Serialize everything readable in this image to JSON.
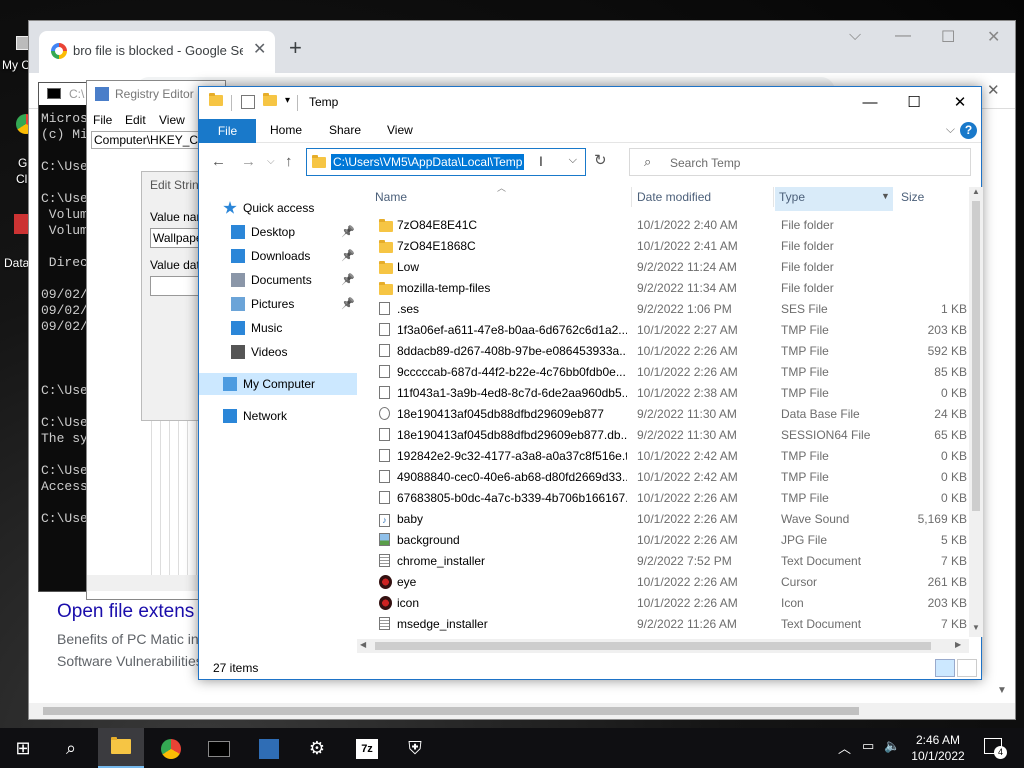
{
  "desktop": {
    "icons": [
      {
        "label": "My C",
        "icon": "my-computer-icon"
      },
      {
        "label": "G",
        "icon": "chrome-icon"
      },
      {
        "label": "Cl",
        "icon": "chrome-icon"
      },
      {
        "label": "Data",
        "icon": "data-icon"
      }
    ]
  },
  "chrome": {
    "tab_title": "bro file is blocked - Google Search",
    "new_tab_glyph": "+",
    "snippet_title": "Open file extens",
    "snippet_line1": "Benefits of PC Matic in",
    "snippet_line2": "Software Vulnerabilities"
  },
  "cmd": {
    "title": "C:\\",
    "lines": [
      "Micros",
      "(c) Mi",
      "",
      "C:\\Use",
      "",
      "C:\\Use",
      " Volum",
      " Volum",
      "",
      " Direc",
      "",
      "09/02/",
      "09/02/",
      "09/02/",
      "",
      "",
      "",
      "C:\\Use",
      "",
      "C:\\Use",
      "The sy",
      "",
      "C:\\Use",
      "Access",
      "",
      "C:\\Use"
    ]
  },
  "registry": {
    "title": "Registry Editor",
    "menu": [
      "File",
      "Edit",
      "View"
    ],
    "address": "Computer\\HKEY_CU",
    "dialog_title": "Edit Strin",
    "value_name_label": "Value nam",
    "value_name": "Wallpape",
    "value_data_label": "Value data"
  },
  "explorer": {
    "title": "Temp",
    "ribbon": {
      "file": "File",
      "tabs": [
        "Home",
        "Share",
        "View"
      ],
      "help": "?"
    },
    "address": "C:\\Users\\VM5\\AppData\\Local\\Temp",
    "search_placeholder": "Search Temp",
    "columns": {
      "name": "Name",
      "date": "Date modified",
      "type": "Type",
      "size": "Size"
    },
    "nav": [
      {
        "label": "Quick access",
        "icon": "star-icon",
        "pinned": false
      },
      {
        "label": "Desktop",
        "icon": "desktop-icon",
        "pinned": true
      },
      {
        "label": "Downloads",
        "icon": "downloads-icon",
        "pinned": true
      },
      {
        "label": "Documents",
        "icon": "documents-icon",
        "pinned": true
      },
      {
        "label": "Pictures",
        "icon": "pictures-icon",
        "pinned": true
      },
      {
        "label": "Music",
        "icon": "music-icon",
        "pinned": false
      },
      {
        "label": "Videos",
        "icon": "videos-icon",
        "pinned": false
      },
      {
        "label": "My Computer",
        "icon": "computer-icon",
        "pinned": false,
        "selected": true
      },
      {
        "label": "Network",
        "icon": "network-icon",
        "pinned": false
      }
    ],
    "files": [
      {
        "name": "7zO84E8E41C",
        "date": "10/1/2022 2:40 AM",
        "type": "File folder",
        "size": "",
        "icon": "folder"
      },
      {
        "name": "7zO84E1868C",
        "date": "10/1/2022 2:41 AM",
        "type": "File folder",
        "size": "",
        "icon": "folder"
      },
      {
        "name": "Low",
        "date": "9/2/2022 11:24 AM",
        "type": "File folder",
        "size": "",
        "icon": "folder"
      },
      {
        "name": "mozilla-temp-files",
        "date": "9/2/2022 11:34 AM",
        "type": "File folder",
        "size": "",
        "icon": "folder"
      },
      {
        "name": ".ses",
        "date": "9/2/2022 1:06 PM",
        "type": "SES File",
        "size": "1 KB",
        "icon": "doc"
      },
      {
        "name": "1f3a06ef-a611-47e8-b0aa-6d6762c6d1a2....",
        "date": "10/1/2022 2:27 AM",
        "type": "TMP File",
        "size": "203 KB",
        "icon": "doc"
      },
      {
        "name": "8ddacb89-d267-408b-97be-e086453933a...",
        "date": "10/1/2022 2:26 AM",
        "type": "TMP File",
        "size": "592 KB",
        "icon": "doc"
      },
      {
        "name": "9cccccab-687d-44f2-b22e-4c76bb0fdb0e...",
        "date": "10/1/2022 2:26 AM",
        "type": "TMP File",
        "size": "85 KB",
        "icon": "doc"
      },
      {
        "name": "11f043a1-3a9b-4ed8-8c7d-6de2aa960db5...",
        "date": "10/1/2022 2:38 AM",
        "type": "TMP File",
        "size": "0 KB",
        "icon": "doc"
      },
      {
        "name": "18e190413af045db88dfbd29609eb877",
        "date": "9/2/2022 11:30 AM",
        "type": "Data Base File",
        "size": "24 KB",
        "icon": "db"
      },
      {
        "name": "18e190413af045db88dfbd29609eb877.db....",
        "date": "9/2/2022 11:30 AM",
        "type": "SESSION64 File",
        "size": "65 KB",
        "icon": "doc"
      },
      {
        "name": "192842e2-9c32-4177-a3a8-a0a37c8f516e.t...",
        "date": "10/1/2022 2:42 AM",
        "type": "TMP File",
        "size": "0 KB",
        "icon": "doc"
      },
      {
        "name": "49088840-cec0-40e6-ab68-d80fd2669d33....",
        "date": "10/1/2022 2:42 AM",
        "type": "TMP File",
        "size": "0 KB",
        "icon": "doc"
      },
      {
        "name": "67683805-b0dc-4a7c-b339-4b706b166167...",
        "date": "10/1/2022 2:26 AM",
        "type": "TMP File",
        "size": "0 KB",
        "icon": "doc"
      },
      {
        "name": "baby",
        "date": "10/1/2022 2:26 AM",
        "type": "Wave Sound",
        "size": "5,169 KB",
        "icon": "audio"
      },
      {
        "name": "background",
        "date": "10/1/2022 2:26 AM",
        "type": "JPG File",
        "size": "5 KB",
        "icon": "image"
      },
      {
        "name": "chrome_installer",
        "date": "9/2/2022 7:52 PM",
        "type": "Text Document",
        "size": "7 KB",
        "icon": "text"
      },
      {
        "name": "eye",
        "date": "10/1/2022 2:26 AM",
        "type": "Cursor",
        "size": "261 KB",
        "icon": "cursor"
      },
      {
        "name": "icon",
        "date": "10/1/2022 2:26 AM",
        "type": "Icon",
        "size": "203 KB",
        "icon": "cursor"
      },
      {
        "name": "msedge_installer",
        "date": "9/2/2022 11:26 AM",
        "type": "Text Document",
        "size": "7 KB",
        "icon": "text"
      }
    ],
    "status": "27 items"
  },
  "taskbar": {
    "items": [
      "start-icon",
      "search-icon",
      "file-explorer-icon",
      "chrome-icon",
      "cmd-icon",
      "registry-icon",
      "settings-icon",
      "7zip-icon",
      "defender-icon"
    ],
    "clock_time": "2:46 AM",
    "clock_date": "10/1/2022",
    "notification_count": "4"
  },
  "colors": {
    "accent": "#1979ca",
    "selection": "#0078d7",
    "nav_selected": "#cce8ff"
  }
}
